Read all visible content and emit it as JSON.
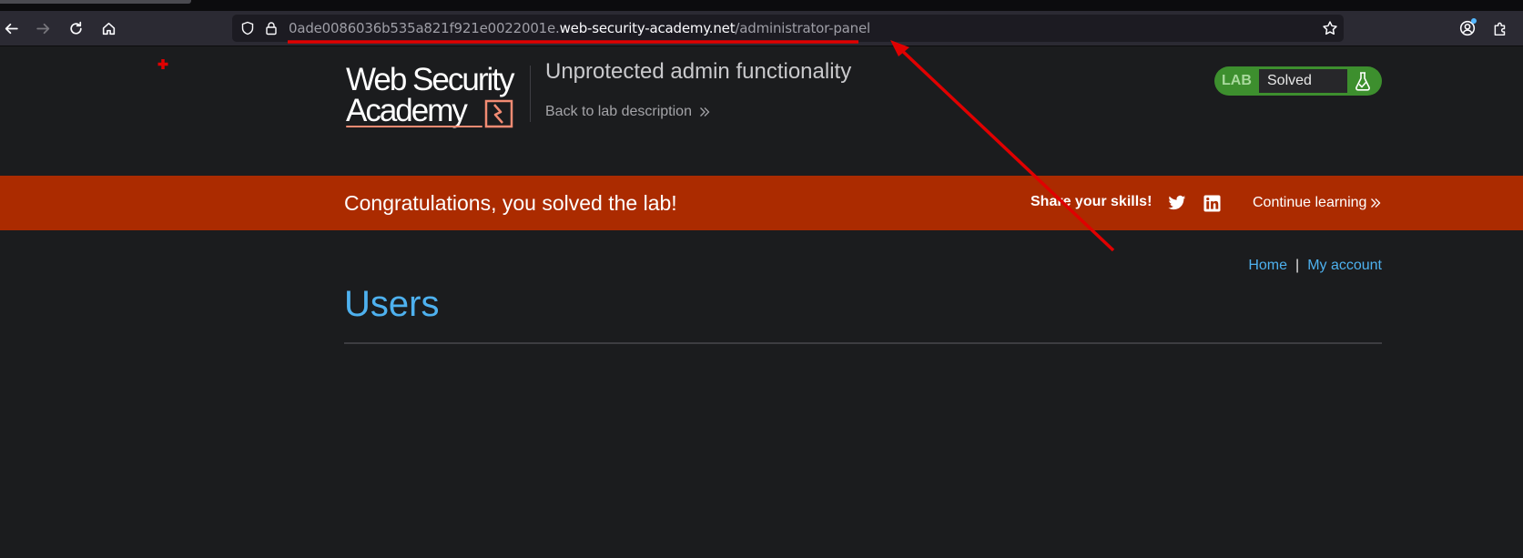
{
  "browser": {
    "url_subdomain": "0ade0086036b535a821f921e0022001e.",
    "url_domain": "web-security-academy.net",
    "url_path": "/administrator-panel",
    "icons": [
      "back-icon",
      "forward-icon",
      "reload-icon",
      "home-icon",
      "shield-icon",
      "lock-icon",
      "bookmark-star-icon",
      "account-icon",
      "extensions-icon"
    ]
  },
  "header": {
    "logo_line1": "Web Security",
    "logo_line2": "Academy",
    "lab_title": "Unprotected admin functionality",
    "back_link": "Back to lab description",
    "status_label": "LAB",
    "status_value": "Solved"
  },
  "banner": {
    "message": "Congratulations, you solved the lab!",
    "share": "Share your skills!",
    "continue": "Continue learning"
  },
  "nav": {
    "home": "Home",
    "separator": "|",
    "account": "My account"
  },
  "main": {
    "heading": "Users"
  },
  "colors": {
    "background": "#1b1c1e",
    "banner": "#ab2b00",
    "link": "#4eb1ef",
    "solved": "#3d8f2e",
    "annotation": "#e00000"
  }
}
